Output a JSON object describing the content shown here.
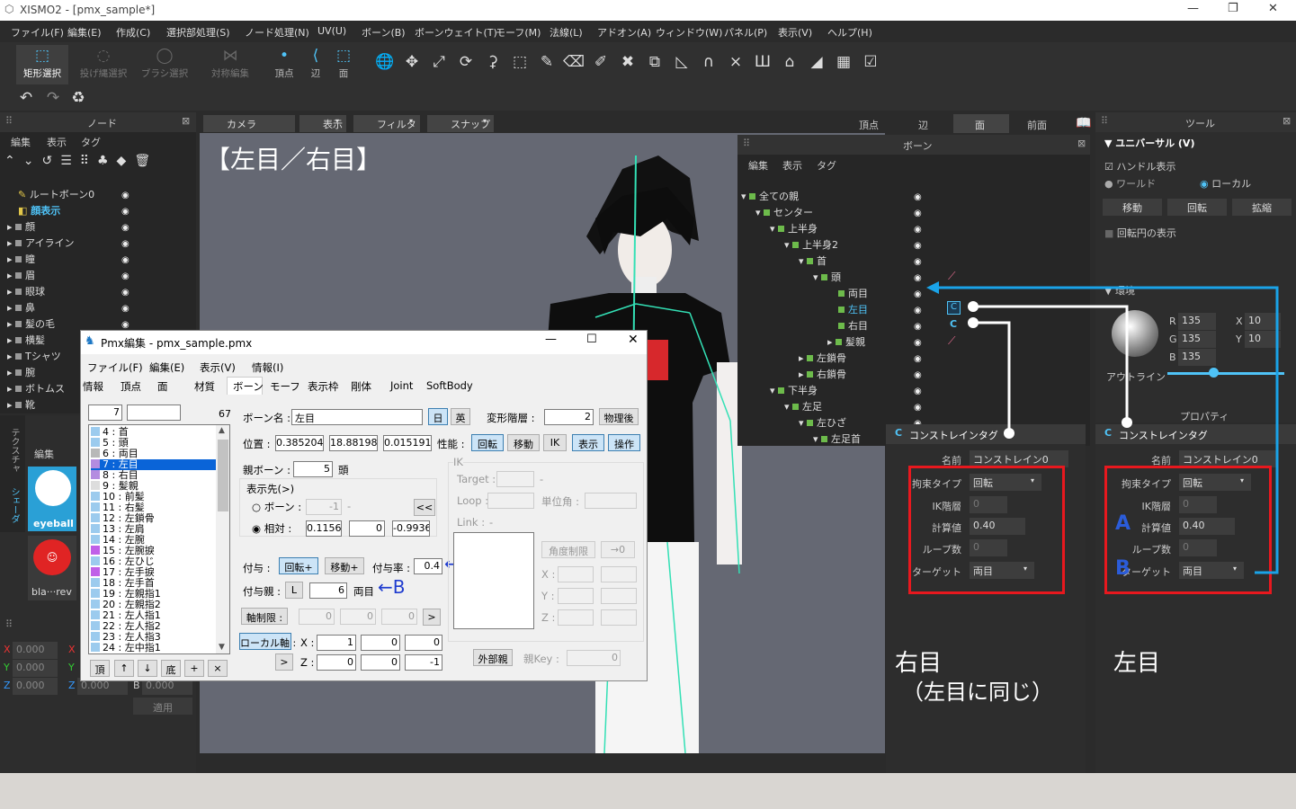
{
  "app": {
    "title": "XISMO2 - [pmx_sample*]"
  },
  "menu": [
    "ファイル(F)",
    "編集(E)",
    "作成(C)",
    "選択部処理(S)",
    "ノード処理(N)",
    "UV(U)",
    "ボーン(B)",
    "ボーンウェイト(T)",
    "モーフ(M)",
    "法線(L)",
    "アドオン(A)",
    "ウィンドウ(W)",
    "パネル(P)",
    "表示(V)",
    "ヘルプ(H)"
  ],
  "toolbar": {
    "rect_select": "矩形選択",
    "lasso_select": "投げ縄選択",
    "brush_select": "ブラシ選択",
    "sym_edit": "対称編集",
    "vertex": "頂点",
    "edge": "辺",
    "face": "面"
  },
  "node_panel": {
    "title": "ノード",
    "menu": [
      "編集",
      "表示",
      "タグ"
    ],
    "items": [
      "ルートボーン0",
      "顔表示",
      "顔",
      "アイライン",
      "瞳",
      "眉",
      "眼球",
      "鼻",
      "髪の毛",
      "横髪",
      "Tシャツ",
      "腕",
      "ボトムス",
      "靴"
    ]
  },
  "viewport": {
    "tabs": [
      "カメラ",
      "表示",
      "フィルタ",
      "スナップ"
    ],
    "modes": [
      "頂点",
      "辺",
      "面",
      "前面"
    ],
    "caption": "【左目／右目】"
  },
  "bone_panel": {
    "title": "ボーン",
    "menu": [
      "編集",
      "表示",
      "タグ"
    ],
    "items": [
      "全ての親",
      "センター",
      "上半身",
      "上半身2",
      "首",
      "頭",
      "両目",
      "左目",
      "右目",
      "髪親",
      "左鎖骨",
      "右鎖骨",
      "下半身",
      "左足",
      "左ひざ",
      "左足首"
    ]
  },
  "tool_panel": {
    "title": "ツール",
    "section": "ユニバーサル (V)",
    "handle": "ハンドル表示",
    "world": "ワールド",
    "local": "ローカル",
    "move": "移動",
    "rotate": "回転",
    "scale": "拡縮",
    "rotcircle": "回転円の表示",
    "env": "環境",
    "R": "135",
    "G": "135",
    "B": "135",
    "X": "10",
    "Y": "10",
    "outline": "アウトライン",
    "property": "プロパティ"
  },
  "texture_panel": {
    "tabs": [
      "テクスチャ",
      "シェーダ"
    ],
    "edit": "編集",
    "items": [
      "eyeball",
      "bla···rev"
    ],
    "coords": {
      "x1": "0.000",
      "y1": "0.000",
      "z1": "0.000",
      "x2": "0.000",
      "y2": "0.000",
      "z2": "0.000",
      "b": "0.000"
    },
    "apply": "適用"
  },
  "constraint_left": {
    "title": "コンストレインタグ",
    "name_label": "名前",
    "name": "コンストレイン0",
    "type_label": "拘束タイプ",
    "type": "回転",
    "ik_label": "IK階層",
    "ik": "0",
    "calc_label": "計算値",
    "calc": "0.40",
    "loop_label": "ループ数",
    "loop": "0",
    "target_label": "ターゲット",
    "target": "両目",
    "caption1": "右目",
    "caption2": "（左目に同じ）"
  },
  "constraint_right": {
    "title": "コンストレインタグ",
    "name_label": "名前",
    "name": "コンストレイン0",
    "type_label": "拘束タイプ",
    "type": "回転",
    "ik_label": "IK階層",
    "ik": "0",
    "calc_label": "計算値",
    "calc": "0.40",
    "loop_label": "ループ数",
    "loop": "0",
    "target_label": "ターゲット",
    "target": "両目",
    "caption": "左目",
    "markA": "A",
    "markB": "B"
  },
  "pmx": {
    "title": "Pmx編集 - pmx_sample.pmx",
    "menu": [
      "ファイル(F)",
      "編集(E)",
      "表示(V)",
      "情報(I)"
    ],
    "tabs": [
      "情報",
      "頂点",
      "面",
      "材質",
      "ボーン",
      "モーフ",
      "表示枠",
      "剛体",
      "Joint",
      "SoftBody"
    ],
    "index": "7",
    "count": "67",
    "bones": [
      "4 : 首",
      "5 : 頭",
      "6 : 両目",
      "7 : 左目",
      "8 : 右目",
      "9 : 髪親",
      "10 : 前髪",
      "11 : 右髪",
      "12 : 左鎖骨",
      "13 : 左肩",
      "14 : 左腕",
      "15 : 左腕捩",
      "16 : 左ひじ",
      "17 : 左手捩",
      "18 : 左手首",
      "19 : 左親指1",
      "20 : 左親指2",
      "21 : 左人指1",
      "22 : 左人指2",
      "23 : 左人指3",
      "24 : 左中指1"
    ],
    "list_buttons": [
      "頂",
      "↑",
      "↓",
      "底",
      "+",
      "×"
    ],
    "bone_name_label": "ボーン名 :",
    "bone_name": "左目",
    "jp": "日",
    "en": "英",
    "deform_label": "変形階層 :",
    "deform": "2",
    "after_physics": "物理後",
    "pos_label": "位置 :",
    "pos": [
      "0.385204",
      "18.88198",
      "0.015191"
    ],
    "perf_label": "性能 :",
    "perf": [
      "回転",
      "移動",
      "IK",
      "表示",
      "操作"
    ],
    "parent_label": "親ボーン :",
    "parent": "5",
    "parent_name": "頭",
    "dest_label": "表示先(>)",
    "bone_opt": "ボーン :",
    "bone_val": "-1",
    "bone_dash": "-",
    "rel_opt": "相対 :",
    "rel": [
      "0.11565",
      "0",
      "-0.9936"
    ],
    "grant_label": "付与 :",
    "grant_rot": "回転+",
    "grant_move": "移動+",
    "rate_label": "付与率 :",
    "rate": "0.4",
    "grant_parent_label": "付与親 :",
    "gp_btn": "L",
    "gp": "6",
    "gp_name": "両目",
    "axis_label": "軸制限 :",
    "axis": [
      "0",
      "0",
      "0"
    ],
    "local_label": "ローカル軸 :",
    "lx": [
      "1",
      "0",
      "0"
    ],
    "lz": [
      "0",
      "0",
      "-1"
    ],
    "X": "X :",
    "Z": "Z :",
    "ik_group": "IK",
    "target_label": "Target :",
    "loop_label": "Loop :",
    "unit_label": "単位角 :",
    "link_label": "Link :",
    "angle_btn": "角度制限",
    "arrow0": "→0",
    "X2": "X :",
    "Y2": "Y :",
    "Z2": "Z :",
    "ext_parent": "外部親",
    "key_label": "親Key :",
    "key": "0",
    "markA": "←A",
    "markB": "←B",
    "dash": "-"
  }
}
